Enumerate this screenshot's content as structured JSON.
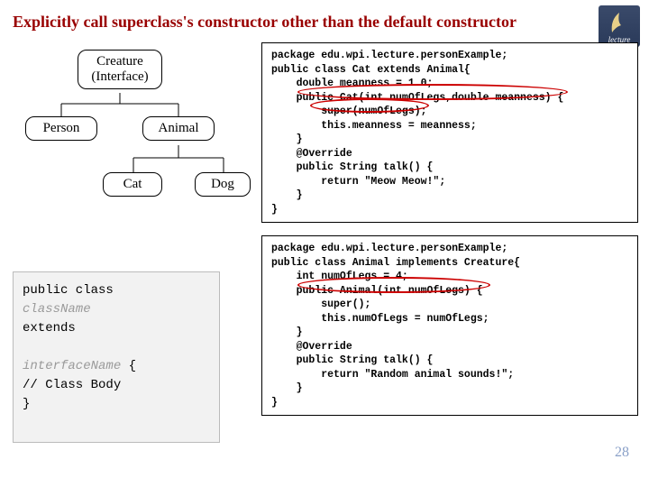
{
  "title": "Explicitly call superclass's constructor other than the default constructor",
  "logo_text": "lecture",
  "hierarchy": {
    "root_line1": "Creature",
    "root_line2": "(Interface)",
    "person": "Person",
    "animal": "Animal",
    "cat": "Cat",
    "dog": "Dog"
  },
  "code1": "package edu.wpi.lecture.personExample;\npublic class Cat extends Animal{\n    double meanness = 1.0;\n    public Cat(int numOfLegs,double meanness) {\n        super(numOfLegs);\n        this.meanness = meanness;\n    }\n    @Override\n    public String talk() {\n        return \"Meow Meow!\";\n    }\n}",
  "code2": "package edu.wpi.lecture.personExample;\npublic class Animal implements Creature{\n    int numOfLegs = 4;\n    public Animal(int numOfLegs) {\n        super();\n        this.numOfLegs = numOfLegs;\n    }\n    @Override\n    public String talk() {\n        return \"Random animal sounds!\";\n    }\n}",
  "snippet": {
    "l1a": "public class",
    "l2": "className",
    "l3": "extends",
    "l5": "interfaceName {",
    "l6": "// Class Body",
    "l7": "}"
  },
  "page_number": "28"
}
